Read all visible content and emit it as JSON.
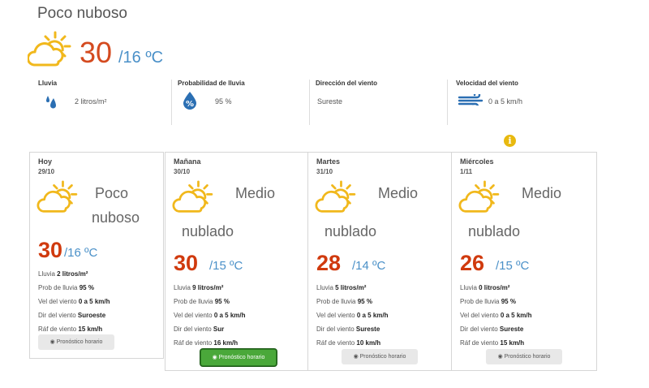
{
  "current": {
    "condition": "Poco nuboso",
    "temp_max": "30",
    "temp_min": "/16 ºC",
    "icon": "partly-cloudy-sun-icon"
  },
  "stats": [
    {
      "label": "Lluvia",
      "value": "2 litros/m²",
      "icon": "rain-drops-icon"
    },
    {
      "label": "Probabilidad de lluvia",
      "value": "95 %",
      "icon": "percent-drop-icon"
    },
    {
      "label": "Dirección del viento",
      "value": "Sureste",
      "icon": ""
    },
    {
      "label": "Velocidad del viento",
      "value": "0 a 5 km/h",
      "icon": "wind-icon"
    }
  ],
  "forecast": [
    {
      "day": "Hoy",
      "date": "29/10",
      "condition_1": "Poco",
      "condition_2": "nuboso",
      "max": "30",
      "min": "/16 ºC",
      "rain_label": "Lluvia ",
      "rain": "2 litros/m²",
      "prob_label": "Prob de lluvia ",
      "prob": "95 %",
      "wind_label": "Vel del viento ",
      "wind": "0 a 5 km/h",
      "dir_label": "Dir del viento ",
      "dir": "Suroeste",
      "gust_label": "Ráf de viento ",
      "gust": "15 km/h",
      "button": "Pronóstico horario",
      "button_style": "grey"
    },
    {
      "day": "Mañana",
      "date": "30/10",
      "condition_1": "Medio",
      "condition_2": "nublado",
      "max": "30",
      "min": "/15 ºC",
      "rain_label": "Lluvia ",
      "rain": "9 litros/m²",
      "prob_label": "Prob de lluvia ",
      "prob": "95 %",
      "wind_label": "Vel del viento ",
      "wind": "0 a 5 km/h",
      "dir_label": "Dir del viento ",
      "dir": "Sur",
      "gust_label": "Ráf de viento ",
      "gust": "16 km/h",
      "button": "Pronóstico horario",
      "button_style": "green"
    },
    {
      "day": "Martes",
      "date": "31/10",
      "condition_1": "Medio",
      "condition_2": "nublado",
      "max": "28",
      "min": "/14 ºC",
      "rain_label": "Lluvia ",
      "rain": "5 litros/m²",
      "prob_label": "Prob de lluvia ",
      "prob": "95 %",
      "wind_label": "Vel del viento ",
      "wind": "0 a 5 km/h",
      "dir_label": "Dir del viento ",
      "dir": "Sureste",
      "gust_label": "Ráf de viento ",
      "gust": "10 km/h",
      "button": "Pronóstico horario",
      "button_style": "grey"
    },
    {
      "day": "Miércoles",
      "date": "1/11",
      "condition_1": "Medio",
      "condition_2": "nublado",
      "max": "26",
      "min": "/15 ºC",
      "rain_label": "Lluvia ",
      "rain": "0 litros/m²",
      "prob_label": "Prob de lluvia ",
      "prob": "95 %",
      "wind_label": "Vel del viento ",
      "wind": "0 a 5 km/h",
      "dir_label": "Dir del viento ",
      "dir": "Sureste",
      "gust_label": "Ráf de viento ",
      "gust": "15 km/h",
      "button": "Pronóstico horario",
      "button_style": "grey"
    }
  ],
  "colors": {
    "accent_max": "#d03a0e",
    "accent_min": "#4a90c8",
    "icon_yellow": "#f1b81c",
    "button_green": "#4aa83a",
    "info_yellow": "#e8b90f"
  }
}
